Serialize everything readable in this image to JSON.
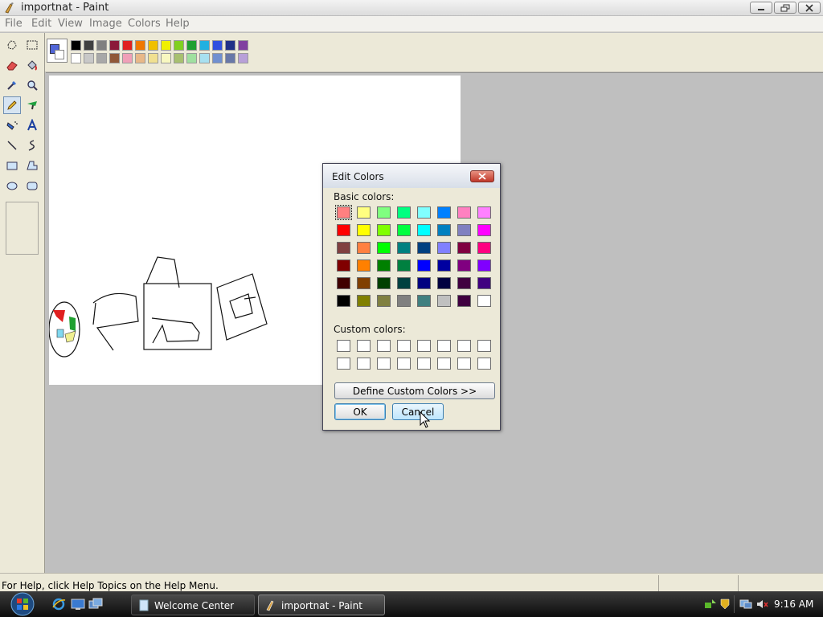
{
  "window": {
    "title": "importnat - Paint",
    "controls": [
      "minimize-icon",
      "maximize-icon",
      "close-icon"
    ]
  },
  "menu": [
    "File",
    "Edit",
    "View",
    "Image",
    "Colors",
    "Help"
  ],
  "tools": [
    {
      "name": "free-form-select-icon"
    },
    {
      "name": "rect-select-icon"
    },
    {
      "name": "eraser-icon"
    },
    {
      "name": "fill-bucket-icon"
    },
    {
      "name": "color-picker-icon"
    },
    {
      "name": "magnifier-icon"
    },
    {
      "name": "pencil-icon"
    },
    {
      "name": "brush-icon"
    },
    {
      "name": "airbrush-icon"
    },
    {
      "name": "text-tool-icon"
    },
    {
      "name": "line-tool-icon"
    },
    {
      "name": "curve-tool-icon"
    },
    {
      "name": "rectangle-tool-icon"
    },
    {
      "name": "polygon-tool-icon"
    },
    {
      "name": "ellipse-tool-icon"
    },
    {
      "name": "rounded-rect-tool-icon"
    }
  ],
  "palette": {
    "foreground": "#5065d8",
    "background": "#ffffff",
    "row1": [
      "#000000",
      "#404040",
      "#808080",
      "#8b1a3a",
      "#e02020",
      "#f07800",
      "#f0c000",
      "#f0f000",
      "#80d020",
      "#20a030",
      "#20b0e0",
      "#3050e0",
      "#203088",
      "#8040a0"
    ],
    "row2": [
      "#ffffff",
      "#c8c8c8",
      "#a8a8a8",
      "#905838",
      "#f0a0b8",
      "#e8b888",
      "#f0e090",
      "#f8f8c0",
      "#a8c070",
      "#a0e0a0",
      "#a8e0f0",
      "#7090d0",
      "#6878a8",
      "#b8a0d8"
    ]
  },
  "status": {
    "help_text": "For Help, click Help Topics on the Help Menu."
  },
  "dialog": {
    "title": "Edit Colors",
    "basic_label": "Basic colors:",
    "custom_label": "Custom colors:",
    "basic_colors": [
      [
        "#ff8080",
        "#ffff80",
        "#80ff80",
        "#00ff80",
        "#80ffff",
        "#0080ff",
        "#ff80c0",
        "#ff80ff"
      ],
      [
        "#ff0000",
        "#ffff00",
        "#80ff00",
        "#00ff40",
        "#00ffff",
        "#0080c0",
        "#8080c0",
        "#ff00ff"
      ],
      [
        "#804040",
        "#ff8040",
        "#00ff00",
        "#008080",
        "#004080",
        "#8080ff",
        "#800040",
        "#ff0080"
      ],
      [
        "#800000",
        "#ff8000",
        "#008000",
        "#008040",
        "#0000ff",
        "#0000a0",
        "#800080",
        "#8000ff"
      ],
      [
        "#400000",
        "#804000",
        "#004000",
        "#004040",
        "#000080",
        "#000040",
        "#400040",
        "#400080"
      ],
      [
        "#000000",
        "#808000",
        "#808040",
        "#808080",
        "#408080",
        "#c0c0c0",
        "#400040",
        "#ffffff"
      ]
    ],
    "custom_rows": 2,
    "custom_cols": 8,
    "define_label": "Define Custom Colors >>",
    "ok_label": "OK",
    "cancel_label": "Cancel"
  },
  "taskbar": {
    "quick_launch": [
      "ie-icon",
      "desktop-icon",
      "switch-windows-icon"
    ],
    "tasks": [
      {
        "label": "Welcome Center",
        "active": false
      },
      {
        "label": "importnat - Paint",
        "active": true
      }
    ],
    "time": "9:16 AM"
  }
}
